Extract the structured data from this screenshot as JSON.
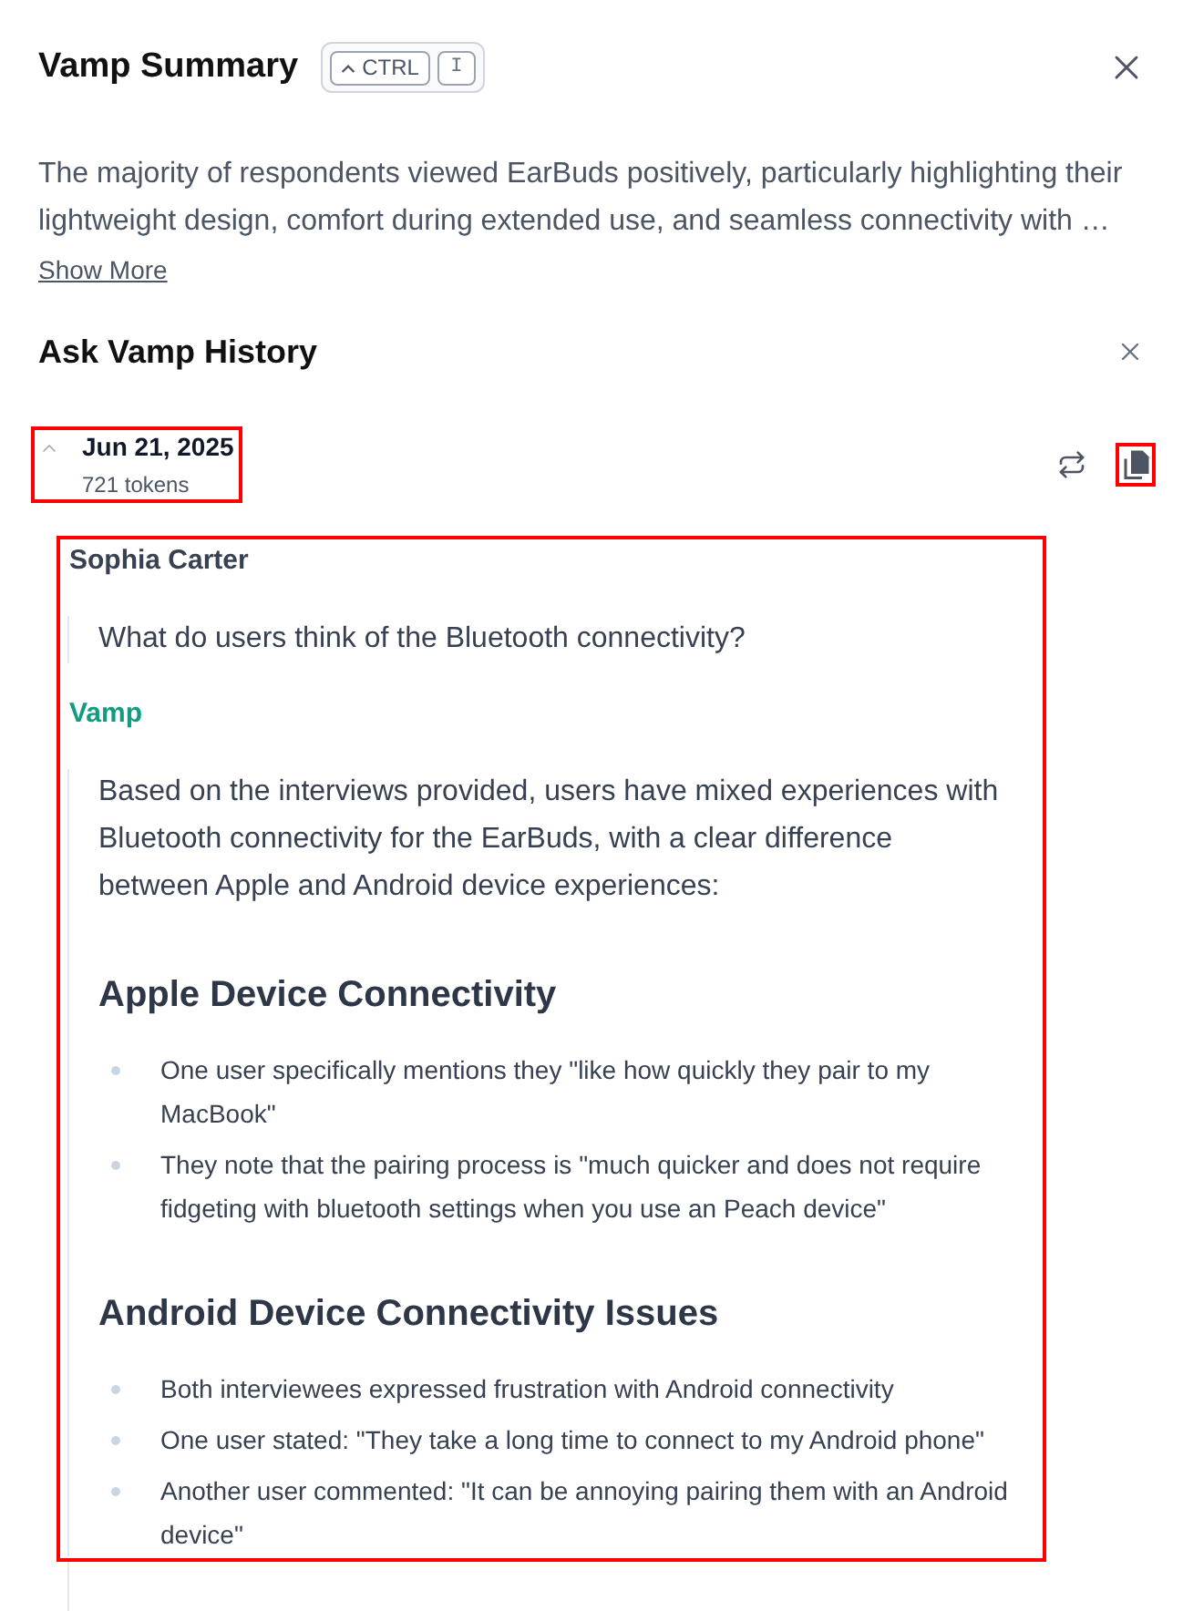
{
  "panel": {
    "title": "Vamp Summary",
    "shortcut": [
      {
        "kind": "modifier",
        "label": "CTRL"
      },
      {
        "kind": "letter",
        "label": "I"
      }
    ]
  },
  "summary": {
    "text": "The majority of respondents viewed EarBuds positively, particularly highlighting their lightweight design, comfort during extended use, and seamless connectivity with …",
    "more_link": "Show More"
  },
  "history": {
    "title": "Ask Vamp History",
    "sessions": [
      {
        "date": "Jun 21, 2025",
        "tokens": "721 tokens",
        "expanded": true,
        "header_highlighted": true,
        "copy_highlighted": true,
        "thread_highlighted": true,
        "messages": [
          {
            "kind": "user",
            "author": "Sophia Carter",
            "blocks": [
              {
                "kind": "paragraph",
                "text": "What do users think of the Bluetooth connectivity?"
              }
            ]
          },
          {
            "kind": "assistant",
            "author": "Vamp",
            "blocks": [
              {
                "kind": "paragraph",
                "text": "Based on the interviews provided, users have mixed experiences with Bluetooth connectivity for the EarBuds, with a clear difference between Apple and Android device experiences:"
              },
              {
                "kind": "heading",
                "text": "Apple Device Connectivity"
              },
              {
                "kind": "list",
                "items": [
                  "One user specifically mentions they \"like how quickly they pair to my MacBook\"",
                  "They note that the pairing process is \"much quicker and does not require fidgeting with bluetooth settings when you use an Peach device\""
                ]
              },
              {
                "kind": "heading",
                "text": "Android Device Connectivity Issues"
              },
              {
                "kind": "list",
                "items": [
                  "Both interviewees expressed frustration with Android connectivity",
                  "One user stated: \"They take a long time to connect to my Android phone\"",
                  "Another user commented: \"It can be annoying pairing them with an Android device\""
                ]
              }
            ]
          }
        ]
      }
    ]
  }
}
